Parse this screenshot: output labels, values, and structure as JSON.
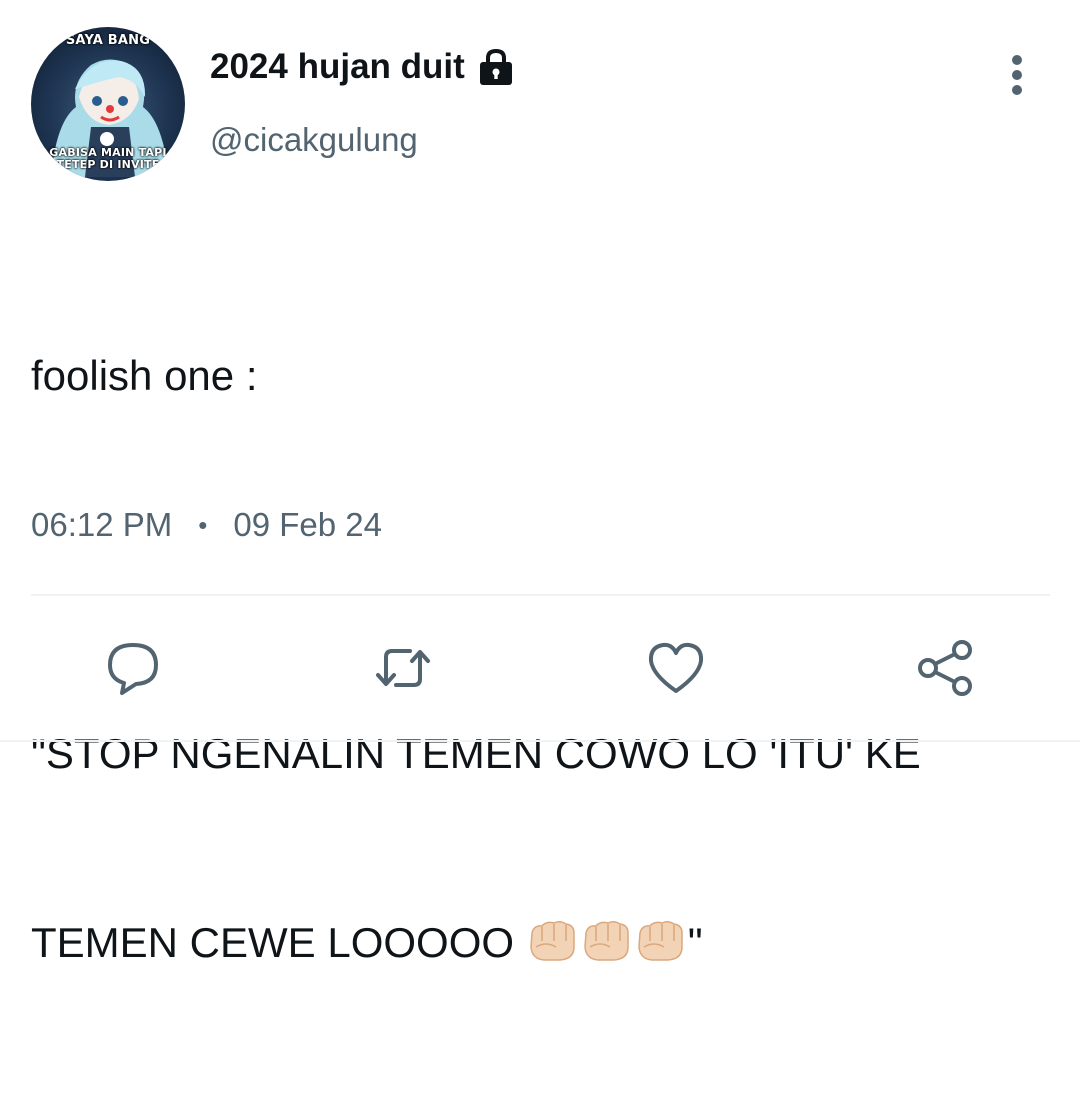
{
  "author": {
    "display_name": "2024 hujan duit",
    "handle": "@cicakgulung",
    "protected_icon": "lock-icon",
    "avatar": {
      "caption_top": "SAYA BANG",
      "caption_bottom_line1": "GABISA MAIN TAPI",
      "caption_bottom_line2": "TETEP DI INVITE"
    }
  },
  "tweet": {
    "line1": "foolish one :",
    "line2": "\"STOP NGENALIN TEMEN COWO LO 'ITU' KE",
    "line3_text": "TEMEN CEWE LOOOOO ",
    "line3_end": "\"",
    "emoji": [
      "fist-icon",
      "fist-icon",
      "fist-icon"
    ]
  },
  "meta": {
    "time": "06:12 PM",
    "separator": "•",
    "date": "09 Feb 24"
  },
  "actions": [
    {
      "name": "reply",
      "icon": "comment-icon"
    },
    {
      "name": "retweet",
      "icon": "retweet-icon"
    },
    {
      "name": "like",
      "icon": "heart-icon"
    },
    {
      "name": "share",
      "icon": "share-icon"
    }
  ],
  "colors": {
    "text": "#0f1419",
    "secondary": "#536471",
    "divider": "#eff3f4"
  }
}
